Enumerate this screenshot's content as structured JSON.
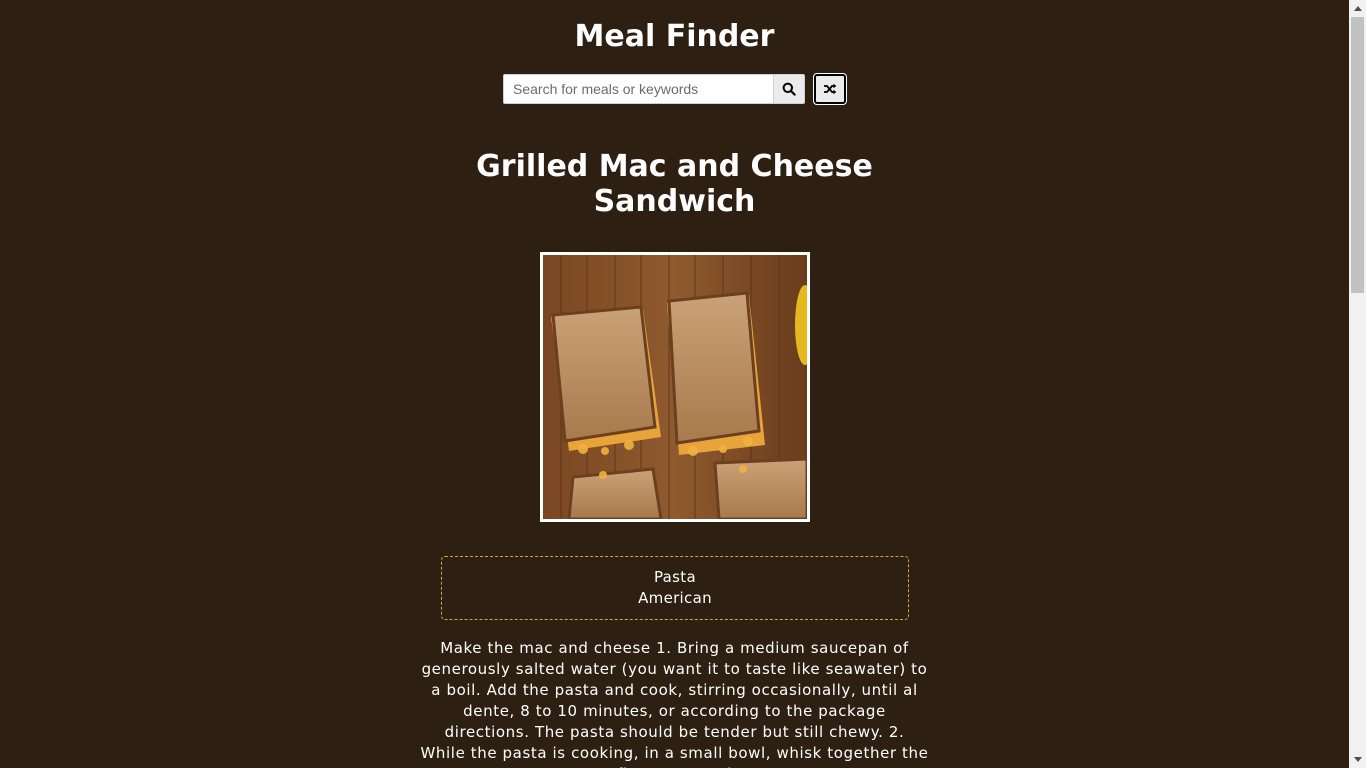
{
  "header": {
    "title": "Meal Finder"
  },
  "search": {
    "placeholder": "Search for meals or keywords",
    "search_icon": "search-icon",
    "random_icon": "shuffle-icon"
  },
  "meal": {
    "title": "Grilled Mac and Cheese Sandwich",
    "category": "Pasta",
    "area": "American",
    "instructions": "Make the mac and cheese 1. Bring a medium saucepan of generously salted water (you want it to taste like seawater) to a boil. Add the pasta and cook, stirring occasionally, until al dente, 8 to 10 minutes, or according to the package directions. The pasta should be tender but still chewy. 2. While the pasta is cooking, in a small bowl, whisk together the flour, mustard"
  },
  "colors": {
    "background": "#2d1f12",
    "accent_border": "#d9a33e"
  }
}
